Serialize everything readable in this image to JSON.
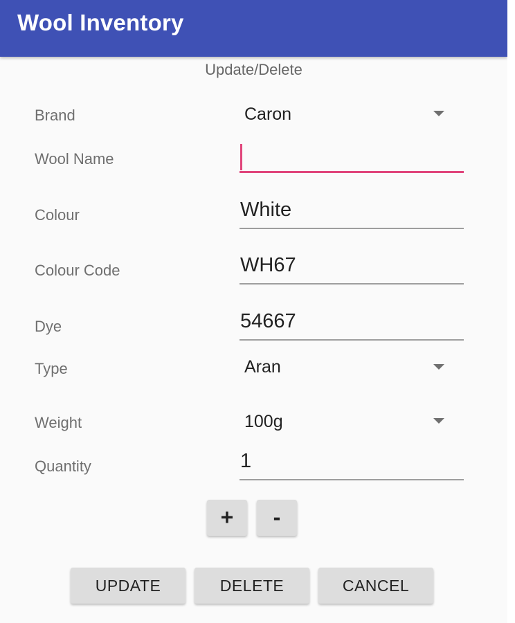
{
  "app": {
    "title": "Wool Inventory"
  },
  "form": {
    "subtitle": "Update/Delete",
    "brand": {
      "label": "Brand",
      "value": "Caron"
    },
    "wool_name": {
      "label": "Wool Name",
      "value": ""
    },
    "colour": {
      "label": "Colour",
      "value": "White"
    },
    "colour_code": {
      "label": "Colour Code",
      "value": "WH67"
    },
    "dye": {
      "label": "Dye",
      "value": "54667"
    },
    "type": {
      "label": "Type",
      "value": "Aran"
    },
    "weight": {
      "label": "Weight",
      "value": "100g"
    },
    "quantity": {
      "label": "Quantity",
      "value": "1"
    }
  },
  "stepper": {
    "plus_label": "+",
    "minus_label": "-"
  },
  "actions": {
    "update_label": "UPDATE",
    "delete_label": "DELETE",
    "cancel_label": "CANCEL"
  },
  "colors": {
    "app_bar": "#3f51b5",
    "accent": "#e0457b",
    "button": "#dddddd"
  },
  "icons": {
    "spinner": "triangle-down-icon"
  }
}
